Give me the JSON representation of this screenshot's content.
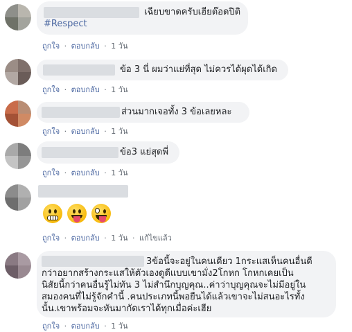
{
  "actions": {
    "like": "ถูกใจ",
    "reply": "ตอบกลับ",
    "dot": "·",
    "edited": "แก้ไขแล้ว"
  },
  "comments": [
    {
      "text": "เฉียบขาดครับเฮียต๊อดปิติ",
      "hashtag": "#Respect",
      "time": "1 วัน"
    },
    {
      "text": "ข้อ 3 นี่ ผมว่าแย่ที่สุด ไม่ควรได้ผุดได้เกิด",
      "time": "1 วัน"
    },
    {
      "text": "ส่วนมากเจอทั้ง 3 ข้อเลยหละ",
      "time": "1 วัน"
    },
    {
      "text": "ข้อ3 แย่สุดพี่",
      "time": "1 วัน"
    },
    {
      "emojis": [
        "grimacing-face",
        "tongue-out-face",
        "zany-face"
      ],
      "time": "1 วัน"
    },
    {
      "lines": [
        "3ข้อนี้จะอยู่ในคนเดียว 1กระแสเห็นคนอื่นดี",
        "กว่าอยากสร้างกระแสให้ตัวเองดูดีแบบเขามั่ง2โกหก โกหกเคยเป็น",
        "นิสัยนี้กว่าคนอื่นรู้ไม่ทัน 3 ไม่สำนึกบุญคุณ..ค่าว่าบุญคุณจะไม่มีอยู่ใน",
        "สมองคนที่ไม่รู้จักคำนี้ .คนประเภทนี้พอยืนได้แล้วเขาจะไม่สนอะไรทั้ง",
        "นั้น.เขาพร้อมจะหันมากัดเราได้ทุกเมื่อค่ะเฮีย"
      ],
      "time": "1 วัน"
    }
  ],
  "colors": {
    "bubble": "#f2f3f5",
    "link": "#4b67a1",
    "meta": "#606770"
  }
}
